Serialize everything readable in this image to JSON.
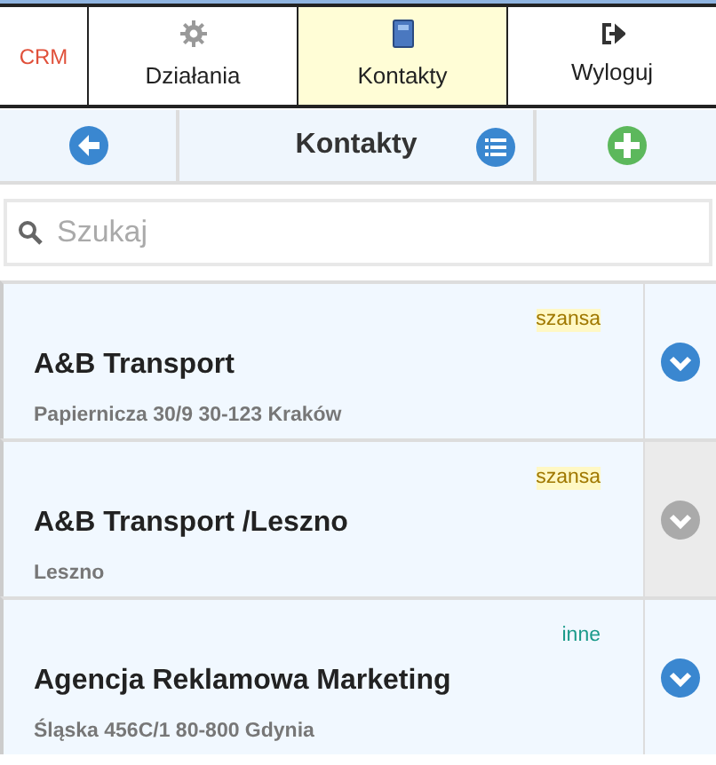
{
  "logo": {
    "text": "CRM"
  },
  "tabs": [
    {
      "label": "Działania",
      "kind": "gear",
      "selected": false
    },
    {
      "label": "Kontakty",
      "kind": "book",
      "selected": true
    },
    {
      "label": "Wyloguj",
      "kind": "logout",
      "selected": false
    }
  ],
  "toolbar": {
    "title": "Kontakty"
  },
  "search": {
    "placeholder": "Szukaj"
  },
  "contacts": [
    {
      "name": "A&B Transport",
      "address": "Papiernicza 30/9 30-123 Kraków",
      "tag": {
        "text": "szansa",
        "kind": "highlight",
        "color": "#a07800"
      },
      "disabled": false
    },
    {
      "name": "A&B Transport /Leszno",
      "address": "Leszno",
      "tag": {
        "text": "szansa",
        "kind": "highlight",
        "color": "#a07800"
      },
      "disabled": true
    },
    {
      "name": "Agencja Reklamowa Marketing",
      "address": "Śląska 456C/1 80-800 Gdynia",
      "tag": {
        "text": "inne",
        "kind": "plain",
        "color": "#1a9a8a"
      },
      "disabled": false
    }
  ]
}
